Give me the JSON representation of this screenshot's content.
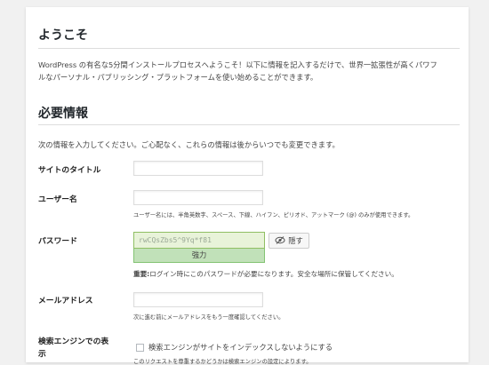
{
  "welcome": {
    "heading": "ようこそ",
    "intro_line1": "WordPress の有名な5分間インストールプロセスへようこそ！以下に情報を記入するだけで、世界一拡張性が高くパワフ",
    "intro_line2": "ルなパーソナル・パブリッシング・プラットフォームを使い始めることができます。"
  },
  "required": {
    "heading": "必要情報",
    "description": "次の情報を入力してください。ご心配なく、これらの情報は後からいつでも変更できます。"
  },
  "fields": {
    "site_title": {
      "label": "サイトのタイトル",
      "value": ""
    },
    "username": {
      "label": "ユーザー名",
      "value": "",
      "hint": "ユーザー名には、半角英数字、スペース、下線、ハイフン、ピリオド、アットマーク (@) のみが使用できます。"
    },
    "password": {
      "label": "パスワード",
      "value": "rwCQsZbs5^9Yq*f81",
      "hide_label": "隠す",
      "strength": "強力",
      "note_bold": "重要:",
      "note": "ログイン時にこのパスワードが必要になります。安全な場所に保管してください。"
    },
    "email": {
      "label": "メールアドレス",
      "value": "",
      "hint": "次に進む前にメールアドレスをもう一度確認してください。"
    },
    "search_engine": {
      "label_line1": "検索エンジンでの表",
      "label_line2": "示",
      "checkbox_label": "検索エンジンがサイトをインデックスしないようにする",
      "checked": false,
      "sub": "このリクエストを尊重するかどうかは検索エンジンの設定によります。"
    }
  },
  "colors": {
    "page_bg": "#f1f1f1",
    "card_bg": "#ffffff",
    "strength_bg": "#c1e1b9",
    "strength_border": "#83c373"
  },
  "icons": {
    "hide_button_icon": "eye-slash-icon"
  }
}
